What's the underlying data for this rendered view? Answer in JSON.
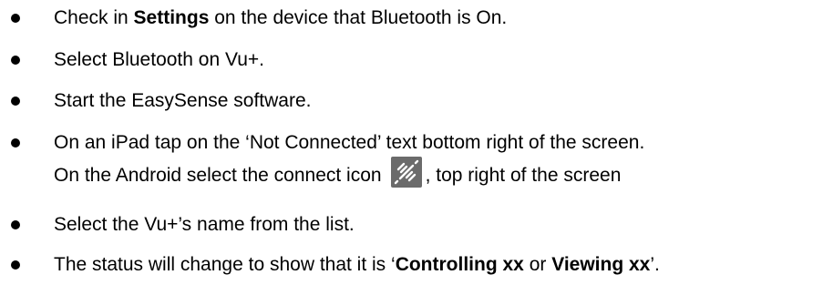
{
  "items": [
    {
      "pre": "Check in ",
      "bold": "Settings",
      "post": " on the device that Bluetooth is On."
    },
    {
      "text": "Select Bluetooth on Vu+."
    },
    {
      "text": "Start the EasySense software."
    },
    {
      "line1": "On an iPad tap on the ‘Not Connected’ text bottom right of the screen.",
      "line2_pre": "On the Android select the connect icon",
      "line2_post": ", top right of the screen",
      "icon": "connect-icon"
    },
    {
      "text": "Select the Vu+’s name from the list."
    },
    {
      "pre": "The status will change to show that it is ‘",
      "bold1": "Controlling xx",
      "mid": " or ",
      "bold2": "Viewing xx",
      "post": "’."
    }
  ],
  "colors": {
    "text": "#000000",
    "icon_bg": "#6b6b6b",
    "icon_fg": "#ffffff"
  }
}
